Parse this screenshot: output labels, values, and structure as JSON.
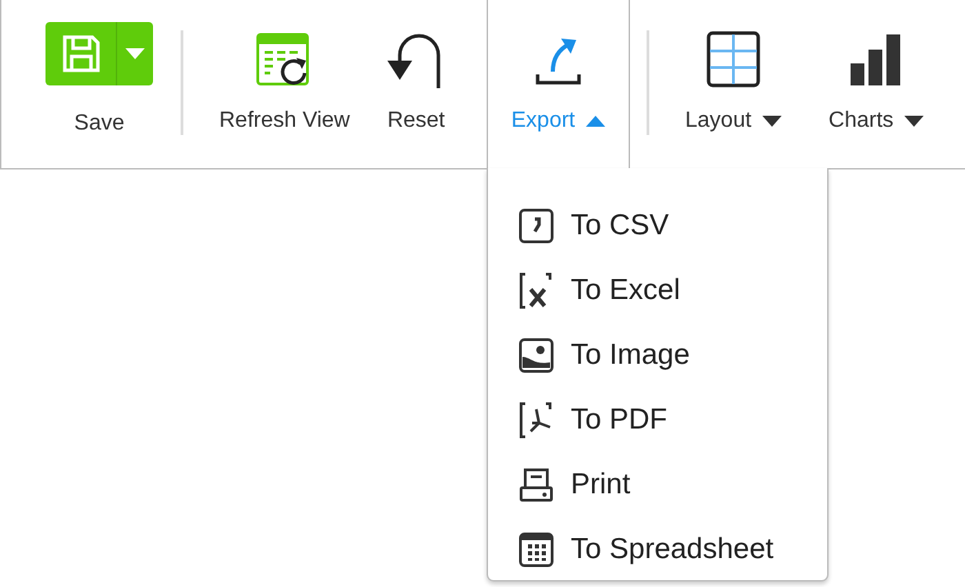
{
  "toolbar": {
    "tools": [
      {
        "kind": "split",
        "label": "Save"
      },
      {
        "kind": "separator"
      },
      {
        "kind": "button",
        "label": "Refresh View"
      },
      {
        "kind": "button",
        "label": "Reset"
      },
      {
        "kind": "dropdown",
        "label": "Export",
        "expanded": true
      },
      {
        "kind": "separator"
      },
      {
        "kind": "dropdown",
        "label": "Layout",
        "expanded": false
      },
      {
        "kind": "dropdown",
        "label": "Charts",
        "expanded": false
      }
    ]
  },
  "export_menu": {
    "items": [
      {
        "label": "To CSV"
      },
      {
        "label": "To Excel"
      },
      {
        "label": "To Image"
      },
      {
        "label": "To PDF"
      },
      {
        "label": "Print"
      },
      {
        "label": "To Spreadsheet"
      }
    ]
  }
}
